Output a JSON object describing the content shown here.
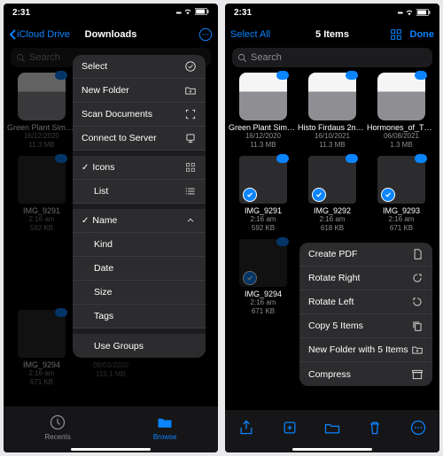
{
  "status": {
    "time": "2:31"
  },
  "accent": "#0a84ff",
  "left": {
    "back": "iCloud Drive",
    "title": "Downloads",
    "search_placeholder": "Search",
    "files": [
      {
        "name": "Green Plant Simpl…ry.zip",
        "date": "16/12/2020",
        "size": "11.3 MB",
        "kind": "zip",
        "cloud": true
      },
      {
        "name": "IMG_9291",
        "date": "2:16 am",
        "size": "592 KB",
        "kind": "img",
        "cloud": true
      },
      {
        "name": "IMG_9294",
        "date": "2:16 am",
        "size": "671 KB",
        "kind": "img",
        "cloud": true
      }
    ],
    "menu": [
      {
        "label": "Select",
        "icon": "select"
      },
      {
        "label": "New Folder",
        "icon": "new-folder"
      },
      {
        "label": "Scan Documents",
        "icon": "scan"
      },
      {
        "label": "Connect to Server",
        "icon": "server"
      }
    ],
    "view": [
      {
        "label": "Icons",
        "icon": "icons",
        "checked": true
      },
      {
        "label": "List",
        "icon": "list",
        "checked": false
      }
    ],
    "sort": [
      {
        "label": "Name",
        "icon": "chevron",
        "checked": true
      },
      {
        "label": "Kind"
      },
      {
        "label": "Date"
      },
      {
        "label": "Size"
      },
      {
        "label": "Tags"
      }
    ],
    "group_label": "Use Groups",
    "tabs": {
      "recents": "Recents",
      "browse": "Browse"
    },
    "under_menu": {
      "size": "115.1 MB",
      "date": "08/03/2020"
    }
  },
  "right": {
    "select_all": "Select All",
    "title": "5 Items",
    "done": "Done",
    "search_placeholder": "Search",
    "files": [
      {
        "name": "Green Plant Simpl…ry.zip",
        "date": "16/12/2020",
        "size": "11.3 MB",
        "kind": "zip",
        "cloud": true,
        "selected": false
      },
      {
        "name": "Histo Firdaus 2nd year",
        "date": "16/10/2021",
        "size": "11.3 MB",
        "kind": "zip",
        "cloud": true,
        "selected": false
      },
      {
        "name": "Hormones_of_The_…ortex",
        "date": "06/08/2021",
        "size": "1.3 MB",
        "kind": "zip",
        "cloud": true,
        "selected": false
      },
      {
        "name": "IMG_9291",
        "date": "2:16 am",
        "size": "592 KB",
        "kind": "img",
        "cloud": true,
        "selected": true
      },
      {
        "name": "IMG_9292",
        "date": "2:16 am",
        "size": "618 KB",
        "kind": "img",
        "cloud": true,
        "selected": true
      },
      {
        "name": "IMG_9293",
        "date": "2:16 am",
        "size": "671 KB",
        "kind": "img",
        "cloud": true,
        "selected": true
      },
      {
        "name": "IMG_9294",
        "date": "2:16 am",
        "size": "671 KB",
        "kind": "img",
        "cloud": true,
        "selected": true
      }
    ],
    "menu": [
      {
        "label": "Create PDF",
        "icon": "pdf"
      },
      {
        "label": "Rotate Right",
        "icon": "rotate-right"
      },
      {
        "label": "Rotate Left",
        "icon": "rotate-left"
      },
      {
        "label": "Copy 5 Items",
        "icon": "copy"
      },
      {
        "label": "New Folder with 5 Items",
        "icon": "folder"
      },
      {
        "label": "Compress",
        "icon": "archive"
      }
    ]
  }
}
